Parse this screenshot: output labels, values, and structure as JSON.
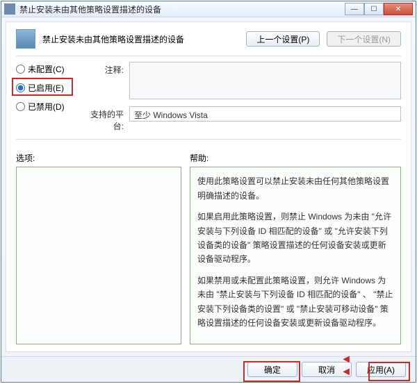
{
  "window": {
    "title": "禁止安装未由其他策略设置描述的设备"
  },
  "header": {
    "policy_title": "禁止安装未由其他策略设置描述的设备",
    "prev_button": "上一个设置(P)",
    "next_button": "下一个设置(N)"
  },
  "radios": {
    "not_configured": "未配置(C)",
    "enabled": "已启用(E)",
    "disabled": "已禁用(D)",
    "selected": "enabled"
  },
  "fields": {
    "comment_label": "注释:",
    "comment_value": "",
    "platform_label": "支持的平台:",
    "platform_value": "至少 Windows Vista"
  },
  "panels": {
    "options_label": "选项:",
    "help_label": "帮助:",
    "help_paragraphs": [
      "使用此策略设置可以禁止安装未由任何其他策略设置明确描述的设备。",
      "如果启用此策略设置，则禁止 Windows 为未由 \"允许安装与下列设备 ID 相匹配的设备\" 或 \"允许安装下列设备类的设备\" 策略设置描述的任何设备安装或更新设备驱动程序。",
      "如果禁用或未配置此策略设置，则允许 Windows 为未由 \"禁止安装与下列设备 ID 相匹配的设备\" 、 \"禁止安装下列设备类的设置\" 或 \"禁止安装可移动设备\" 策略设置描述的任何设备安装或更新设备驱动程序。"
    ]
  },
  "footer": {
    "ok": "确定",
    "cancel": "取消",
    "apply": "应用(A)"
  }
}
